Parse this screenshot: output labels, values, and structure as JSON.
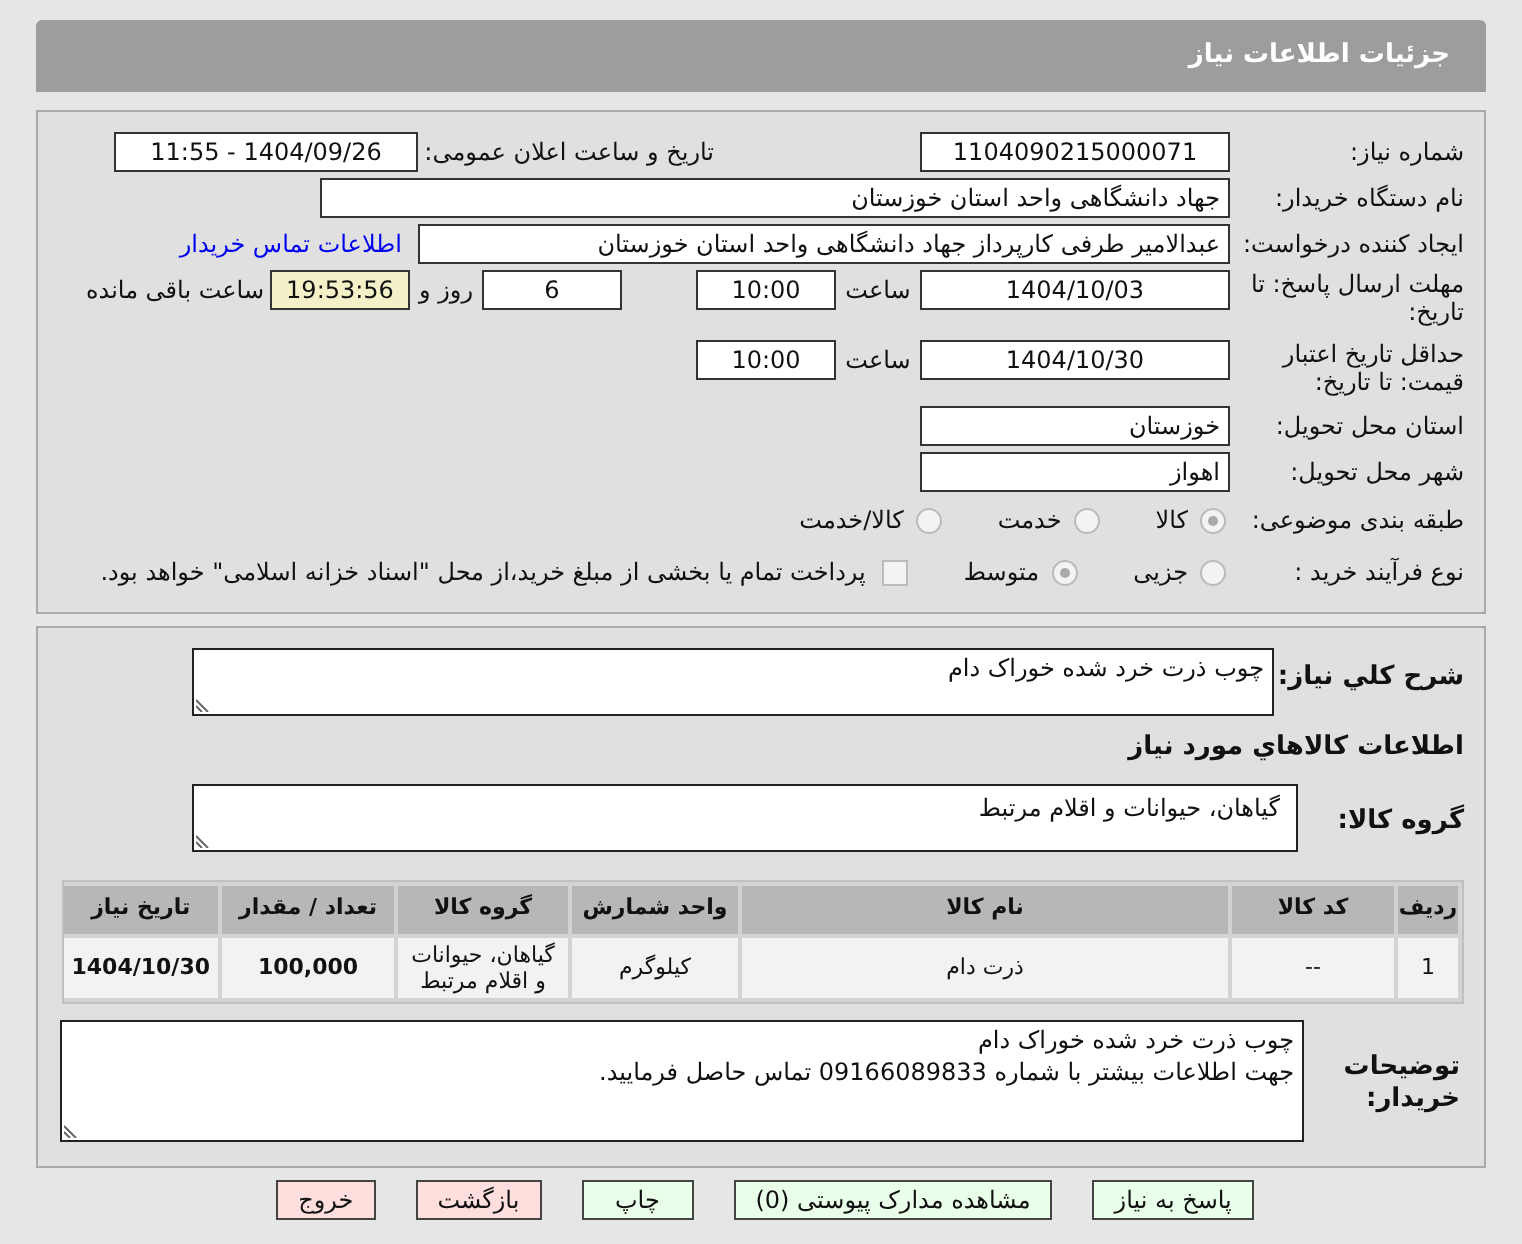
{
  "header": {
    "title": "جزئیات اطلاعات نیاز"
  },
  "need_number": {
    "label": "شماره نیاز:",
    "value": "1104090215000071"
  },
  "announce": {
    "label": "تاریخ و ساعت اعلان عمومی:",
    "value": "1404/09/26 - 11:55"
  },
  "buyer_org": {
    "label": "نام دستگاه خریدار:",
    "value": "جهاد دانشگاهی واحد استان خوزستان"
  },
  "requester": {
    "label": "ایجاد کننده درخواست:",
    "value": "عبدالامیر طرفی کارپرداز جهاد دانشگاهی واحد استان خوزستان",
    "link": "اطلاعات تماس خریدار"
  },
  "deadline": {
    "label": "مهلت ارسال پاسخ: تا تاریخ:",
    "date": "1404/10/03",
    "time_label": "ساعت",
    "time": "10:00",
    "days": "6",
    "days_label": "روز و",
    "remaining": "19:53:56",
    "remaining_label": "ساعت باقی مانده"
  },
  "price_validity": {
    "label": "حداقل تاریخ اعتبار قیمت: تا تاریخ:",
    "date": "1404/10/30",
    "time_label": "ساعت",
    "time": "10:00"
  },
  "province": {
    "label": "استان محل تحویل:",
    "value": "خوزستان"
  },
  "city": {
    "label": "شهر محل تحویل:",
    "value": "اهواز"
  },
  "category": {
    "label": "طبقه بندی موضوعی:",
    "options": [
      {
        "label": "کالا",
        "selected": true,
        "disabled": true
      },
      {
        "label": "خدمت",
        "selected": false,
        "disabled": true
      },
      {
        "label": "کالا/خدمت",
        "selected": false,
        "disabled": true
      }
    ]
  },
  "process": {
    "label": "نوع فرآیند خرید :",
    "options": [
      {
        "label": "جزیی",
        "selected": false,
        "disabled": true
      },
      {
        "label": "متوسط",
        "selected": true,
        "disabled": true
      }
    ],
    "treasury": {
      "checked": false,
      "label": "پرداخت تمام یا بخشی از مبلغ خرید،از محل \"اسناد خزانه اسلامی\" خواهد بود."
    }
  },
  "description": {
    "label": "شرح کلي نياز:",
    "value": "چوب ذرت خرد شده خوراک دام"
  },
  "goods_heading": "اطلاعات کالاهاي مورد نياز",
  "goods_group": {
    "label": "گروه کالا:",
    "value": "گیاهان، حیوانات و اقلام مرتبط"
  },
  "table": {
    "columns": [
      "رديف",
      "کد کالا",
      "نام کالا",
      "واحد شمارش",
      "گروه کالا",
      "تعداد / مقدار",
      "تاریخ نیاز"
    ],
    "rows": [
      [
        "1",
        "--",
        "ذرت دام",
        "کیلوگرم",
        "گیاهان، حیوانات و اقلام مرتبط",
        "100,000",
        "1404/10/30"
      ]
    ]
  },
  "buyer_notes": {
    "label": "توضیحات خریدار:",
    "lines": [
      "چوب ذرت خرد شده خوراک دام",
      "جهت اطلاعات بیشتر با شماره 09166089833 تماس حاصل فرمایید."
    ]
  },
  "buttons": [
    {
      "label": "پاسخ به نیاز",
      "kind": "primary"
    },
    {
      "label": "مشاهده مدارک پیوستی (0)",
      "kind": "primary"
    },
    {
      "label": "چاپ",
      "kind": "primary"
    },
    {
      "label": "بازگشت",
      "kind": "danger"
    },
    {
      "label": "خروج",
      "kind": "danger"
    }
  ]
}
